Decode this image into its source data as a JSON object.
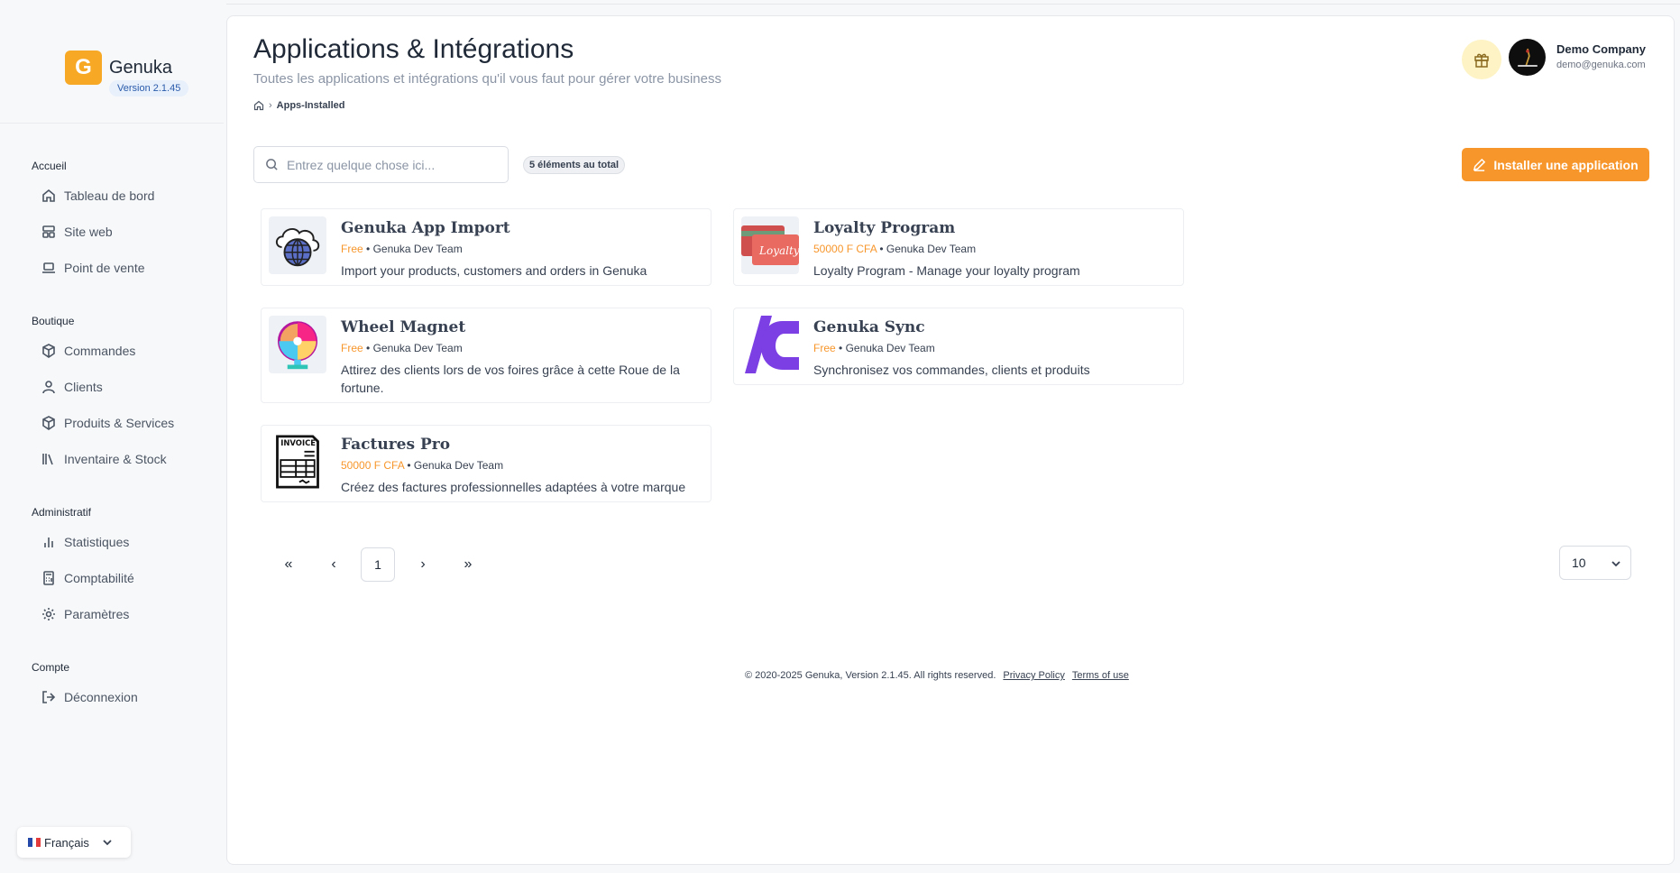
{
  "brand": {
    "name": "Genuka",
    "logo_letter": "G",
    "version": "Version 2.1.45",
    "accent": "#f7a825"
  },
  "sidebar": {
    "sections": [
      {
        "title": "Accueil",
        "items": [
          {
            "label": "Tableau de bord",
            "icon": "home-icon"
          },
          {
            "label": "Site web",
            "icon": "layout-icon"
          },
          {
            "label": "Point de vente",
            "icon": "laptop-icon"
          }
        ]
      },
      {
        "title": "Boutique",
        "items": [
          {
            "label": "Commandes",
            "icon": "package-icon"
          },
          {
            "label": "Clients",
            "icon": "user-icon"
          },
          {
            "label": "Produits & Services",
            "icon": "box-icon"
          },
          {
            "label": "Inventaire & Stock",
            "icon": "library-icon"
          }
        ]
      },
      {
        "title": "Administratif",
        "items": [
          {
            "label": "Statistiques",
            "icon": "bar-chart-icon"
          },
          {
            "label": "Comptabilité",
            "icon": "calculator-icon"
          },
          {
            "label": "Paramètres",
            "icon": "gear-icon"
          }
        ]
      },
      {
        "title": "Compte",
        "items": [
          {
            "label": "Déconnexion",
            "icon": "logout-icon"
          }
        ]
      }
    ],
    "language": "Français"
  },
  "header": {
    "title": "Applications & Intégrations",
    "subtitle": "Toutes les applications et intégrations qu'il vous faut pour gérer votre business",
    "breadcrumb_current": "Apps-Installed",
    "company_name": "Demo Company",
    "company_email": "demo@genuka.com"
  },
  "toolbar": {
    "search_placeholder": "Entrez quelque chose ici...",
    "count_badge": "5 éléments au total",
    "install_label": "Installer une application",
    "install_color": "#f7962b"
  },
  "apps": [
    {
      "name": "Genuka App Import",
      "price": "Free",
      "author": "Genuka Dev Team",
      "description": "Import your products, customers and orders in Genuka",
      "icon": "globe-cloud-icon"
    },
    {
      "name": "Loyalty Program",
      "price": "50000 F CFA",
      "author": "Genuka Dev Team",
      "description": "Loyalty Program - Manage your loyalty program",
      "icon": "loyalty-card-icon"
    },
    {
      "name": "Wheel Magnet",
      "price": "Free",
      "author": "Genuka Dev Team",
      "description": "Attirez des clients lors de vos foires grâce à cette Roue de la fortune.",
      "icon": "fortune-wheel-icon"
    },
    {
      "name": "Genuka Sync",
      "price": "Free",
      "author": "Genuka Dev Team",
      "description": "Synchronisez vos commandes, clients et produits",
      "icon": "sync-logo-icon"
    },
    {
      "name": "Factures Pro",
      "price": "50000 F CFA",
      "author": "Genuka Dev Team",
      "description": "Créez des factures professionnelles adaptées à votre marque",
      "icon": "invoice-icon"
    }
  ],
  "pagination": {
    "first": "«",
    "prev": "‹",
    "current": "1",
    "next": "›",
    "last": "»",
    "page_size": "10"
  },
  "footer": {
    "copyright": "© 2020-2025 Genuka, Version 2.1.45. All rights reserved.",
    "privacy": "Privacy Policy",
    "terms": "Terms of use"
  }
}
